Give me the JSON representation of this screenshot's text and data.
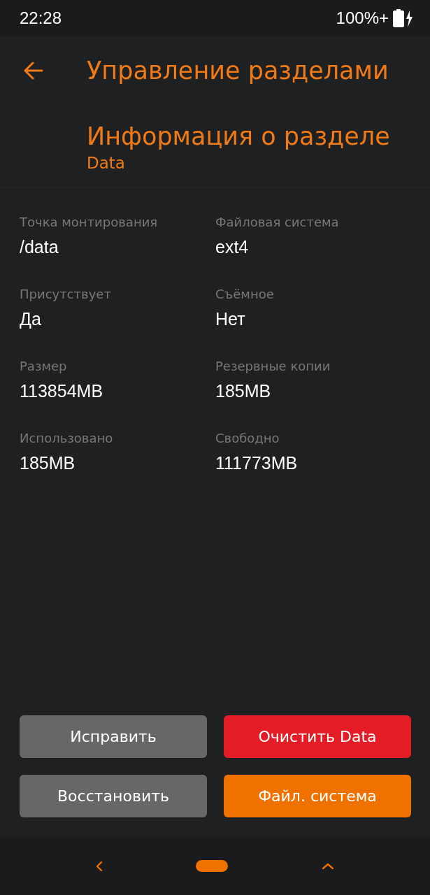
{
  "status_bar": {
    "time": "22:28",
    "battery": "100%+"
  },
  "header": {
    "title": "Управление разделами",
    "subtitle": "Информация о разделе",
    "partition": "Data"
  },
  "fields": [
    {
      "label": "Точка монтирования",
      "value": "/data"
    },
    {
      "label": "Файловая система",
      "value": "ext4"
    },
    {
      "label": "Присутствует",
      "value": "Да"
    },
    {
      "label": "Съёмное",
      "value": "Нет"
    },
    {
      "label": "Размер",
      "value": "113854MB"
    },
    {
      "label": "Резервные копии",
      "value": "185MB"
    },
    {
      "label": "Использовано",
      "value": "185MB"
    },
    {
      "label": "Свободно",
      "value": "111773MB"
    }
  ],
  "buttons": [
    {
      "label": "Исправить",
      "kind": "neutral"
    },
    {
      "label": "Очистить Data",
      "kind": "danger"
    },
    {
      "label": "Восстановить",
      "kind": "neutral"
    },
    {
      "label": "Файл. система",
      "kind": "primary"
    }
  ]
}
